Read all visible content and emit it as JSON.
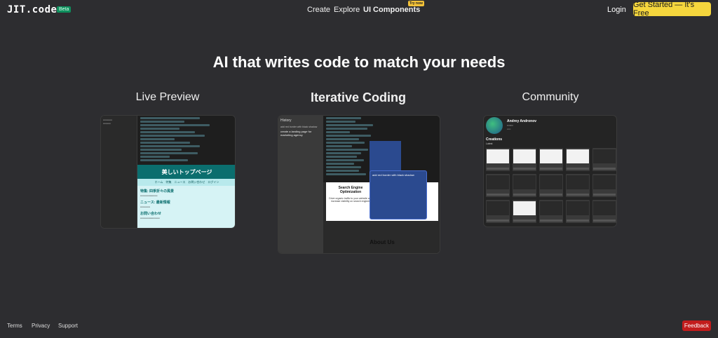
{
  "header": {
    "logo": "JIT.codes",
    "beta_badge": "Beta",
    "nav": {
      "create": "Create",
      "explore": "Explore",
      "ui_components": "UI Components",
      "try_now": "Try now"
    },
    "login": "Login",
    "get_started": "Get Started — It's Free"
  },
  "hero": {
    "title": "AI that writes code to match your needs"
  },
  "columns": {
    "live_preview": "Live Preview",
    "iterative_coding": "Iterative Coding",
    "community": "Community"
  },
  "live_preview_card": {
    "banner": "美しいトップページ",
    "nav": "ホーム　特集　ニュース　お問い合わせ　ログイン",
    "section1_title": "特集: 四季折々の風景",
    "section2_title": "ニュース: 最新情報",
    "section3_title": "お問い合わせ"
  },
  "iterative_card": {
    "history_title": "History",
    "prompt1": "add red border with black shadow",
    "prompt2": "create a landing page for marketing agency",
    "seo_title": "Search Engine Optimization",
    "seo_text": "Drive organic traffic to your website and increase visibility on search engines",
    "popup_prompt": "add red border with black shadow",
    "about": "About Us"
  },
  "community_card": {
    "name": "Andrey Andronov",
    "creations": "Creations",
    "latest": "Latest"
  },
  "footer": {
    "terms": "Terms",
    "privacy": "Privacy",
    "support": "Support",
    "feedback": "Feedback"
  }
}
